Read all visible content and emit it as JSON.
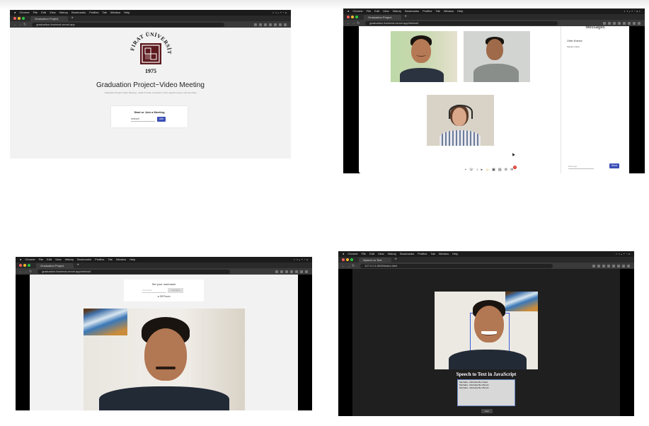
{
  "colors": {
    "accent": "#3b4fb8",
    "maroon": "#5c1a1f",
    "darkbg": "#1f1f1f",
    "lightbg": "#f2f2f2"
  },
  "shot1": {
    "tab_title": "Graduation Project",
    "url": "graduation-frontend.vercel.app",
    "logo": {
      "ring_text": "FIRAT ÜNİVERSİTESİ",
      "year": "1975"
    },
    "title": "Graduation Project~Video Meeting",
    "subtitle": "Graduation Project Video Meeting - Audio & Video connection, chat, speech-to-text, and recording",
    "card_title": "Start or Join a Meeting",
    "input_value": "hellow0",
    "join_label": "Join"
  },
  "shot2": {
    "tab_title": "Graduation Project",
    "url": "graduation-frontend.vercel.app/hellow0",
    "panel_title": "Messages",
    "msg_user": "Other Exterior",
    "msg_text": "Speak motion",
    "message_placeholder": "Message",
    "send_label": "Send",
    "chat_badge": "2",
    "icons": [
      "camera-icon",
      "phone-icon",
      "mic-icon",
      "video-icon",
      "emoji-icon",
      "screen-share-icon",
      "record-icon",
      "settings-icon",
      "chat-icon"
    ]
  },
  "shot3": {
    "tab_title": "Graduation Project",
    "url": "graduation-frontend.vercel.app/hellow0",
    "card_title": "Set your username",
    "input_placeholder": "Username",
    "connect_label": "Connect",
    "toggle_label": "Off Room"
  },
  "shot4": {
    "tab_title": "Speech to Text",
    "url": "127.0.0.1:5500/index.html",
    "title": "Speech to Text in JavaScript",
    "lines": [
      "Merhaba - Merhaba Ben Nasıl",
      "Merhaba - Merhaba Ben Benim",
      "Merhaba - Merhaba Ben Benim"
    ],
    "button_label": "Start"
  }
}
